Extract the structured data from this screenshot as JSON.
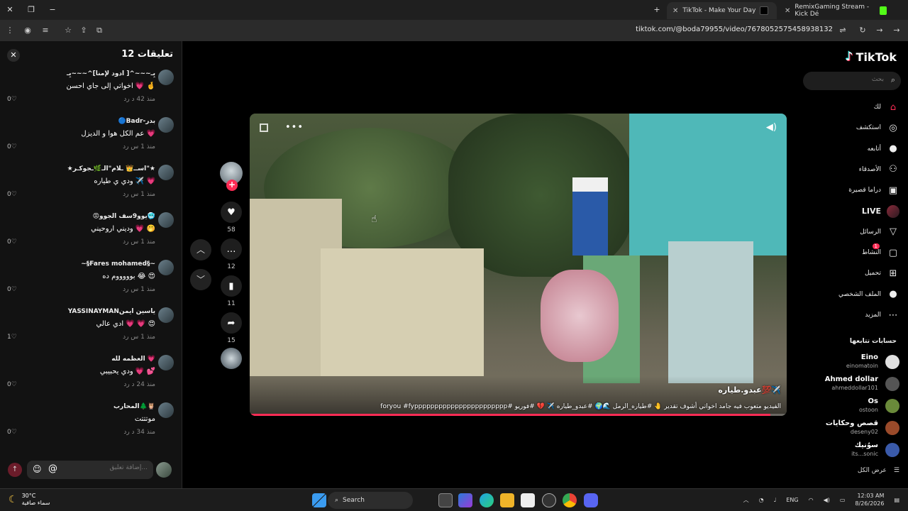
{
  "browser": {
    "tabs": [
      {
        "title": "TikTok - Make Your Day",
        "active": true
      },
      {
        "title": "RemixGaming Stream - Kick Dé",
        "active": false
      }
    ],
    "url": "tiktok.com/@boda79955/video/7678052575458938132"
  },
  "comments": {
    "title": "تعليقات 12",
    "items": [
      {
        "user": "بِـ~~~^[ ادود لإمنا]^~~~بِـ",
        "text": "اخواتي إلى جاي احسن 💗 🤞",
        "meta": "منذ 42 د  رد",
        "likes": "0"
      },
      {
        "user": "🔵Badr-بدر",
        "text": "عم الكل هوا و الديزل 💗",
        "meta": "منذ 1 س  رد",
        "likes": "0"
      },
      {
        "user": "★اســ👑 ـلام\"الـ🌿ـجوكـر\"★",
        "text": "ودي ي طياره ✈️ 💗",
        "meta": "منذ 1 س  رد",
        "likes": "0"
      },
      {
        "user": "😡يوو9سف الجوو🥶",
        "text": "وديني اروحيني 💗 🤭",
        "meta": "منذ 1 س  رد",
        "likes": "0"
      },
      {
        "user": "~§Fares mohamed§~",
        "text": "بوووووم ده 😂 😍",
        "meta": "منذ 1 س  رد",
        "likes": "0"
      },
      {
        "user": "YASSINAYMANياسين ايمن",
        "text": "ادي عالي 💗 💗 😍",
        "meta": "منذ 1 س  رد",
        "likes": "1"
      },
      {
        "user": "العظمه لله 💗",
        "text": "ودي يحبيبي 💗 💕",
        "meta": "منذ 24 د  رد",
        "likes": "0"
      },
      {
        "user": "المحارب🌲🦉",
        "text": "موتتتت",
        "meta": "منذ 34 د  رد",
        "likes": "0"
      }
    ],
    "input_placeholder": "إضافة تعليق...",
    "emoji_icon": "☺",
    "at_icon": "@"
  },
  "actions": {
    "likes": "58",
    "comments": "12",
    "saves": "11",
    "shares": "15"
  },
  "video": {
    "author": "عبدو.طياره💯✈️",
    "caption": "الفيديو متعوب فيه جامد اخواتي أشوف تقدير 🤚 #طياره_الرمل 🌊🌍 #عبدو_طياره ✈️ 💔 #فوريو #foryou #fyppppppppppppppppppppppp",
    "progress": 0.97
  },
  "sidebar": {
    "logo": "TikTok",
    "search_placeholder": "بحث",
    "nav": [
      {
        "label": "لك",
        "icon": "home-icon",
        "glyph": "⌂"
      },
      {
        "label": "استكشف",
        "icon": "compass-icon",
        "glyph": "◎"
      },
      {
        "label": "أتابعه",
        "icon": "following-icon",
        "glyph": "●"
      },
      {
        "label": "الأصدقاء",
        "icon": "friends-icon",
        "glyph": "⚇"
      },
      {
        "label": "دراما قصيرة",
        "icon": "drama-icon",
        "glyph": "▣"
      },
      {
        "label": "LIVE",
        "icon": "live-icon",
        "glyph": ""
      },
      {
        "label": "الرسائل",
        "icon": "messages-icon",
        "glyph": "▽"
      },
      {
        "label": "النشاط",
        "icon": "activity-icon",
        "glyph": "▢",
        "badge": "1"
      },
      {
        "label": "تحميل",
        "icon": "upload-icon",
        "glyph": "⊞"
      },
      {
        "label": "الملف الشخصي",
        "icon": "profile-icon",
        "glyph": "●"
      },
      {
        "label": "المزيد",
        "icon": "more-icon",
        "glyph": "⋯"
      }
    ],
    "following_title": "حسابات تتابعها",
    "accounts": [
      {
        "name": "Eino",
        "handle": "einomatoin",
        "color": "#e0e0e0"
      },
      {
        "name": "Ahmed dollar",
        "handle": "ahmeddollar101",
        "color": "#555"
      },
      {
        "name": "Os",
        "handle": "ostoon",
        "color": "#6a8a3a"
      },
      {
        "name": "قصص وحكايات",
        "handle": "deseny02",
        "color": "#9a4a2a"
      },
      {
        "name": "سوُنيك",
        "handle": "its...sonic",
        "color": "#3a5aaa"
      }
    ],
    "see_all": "عرض الكل"
  },
  "taskbar": {
    "weather_temp": "30°C",
    "weather_desc": "سماء صافية",
    "search_label": "Search",
    "lang": "ENG",
    "time": "12:03 AM",
    "date": "8/26/2026"
  },
  "colors": {
    "accent": "#fe2c55",
    "panel": "#121212"
  }
}
